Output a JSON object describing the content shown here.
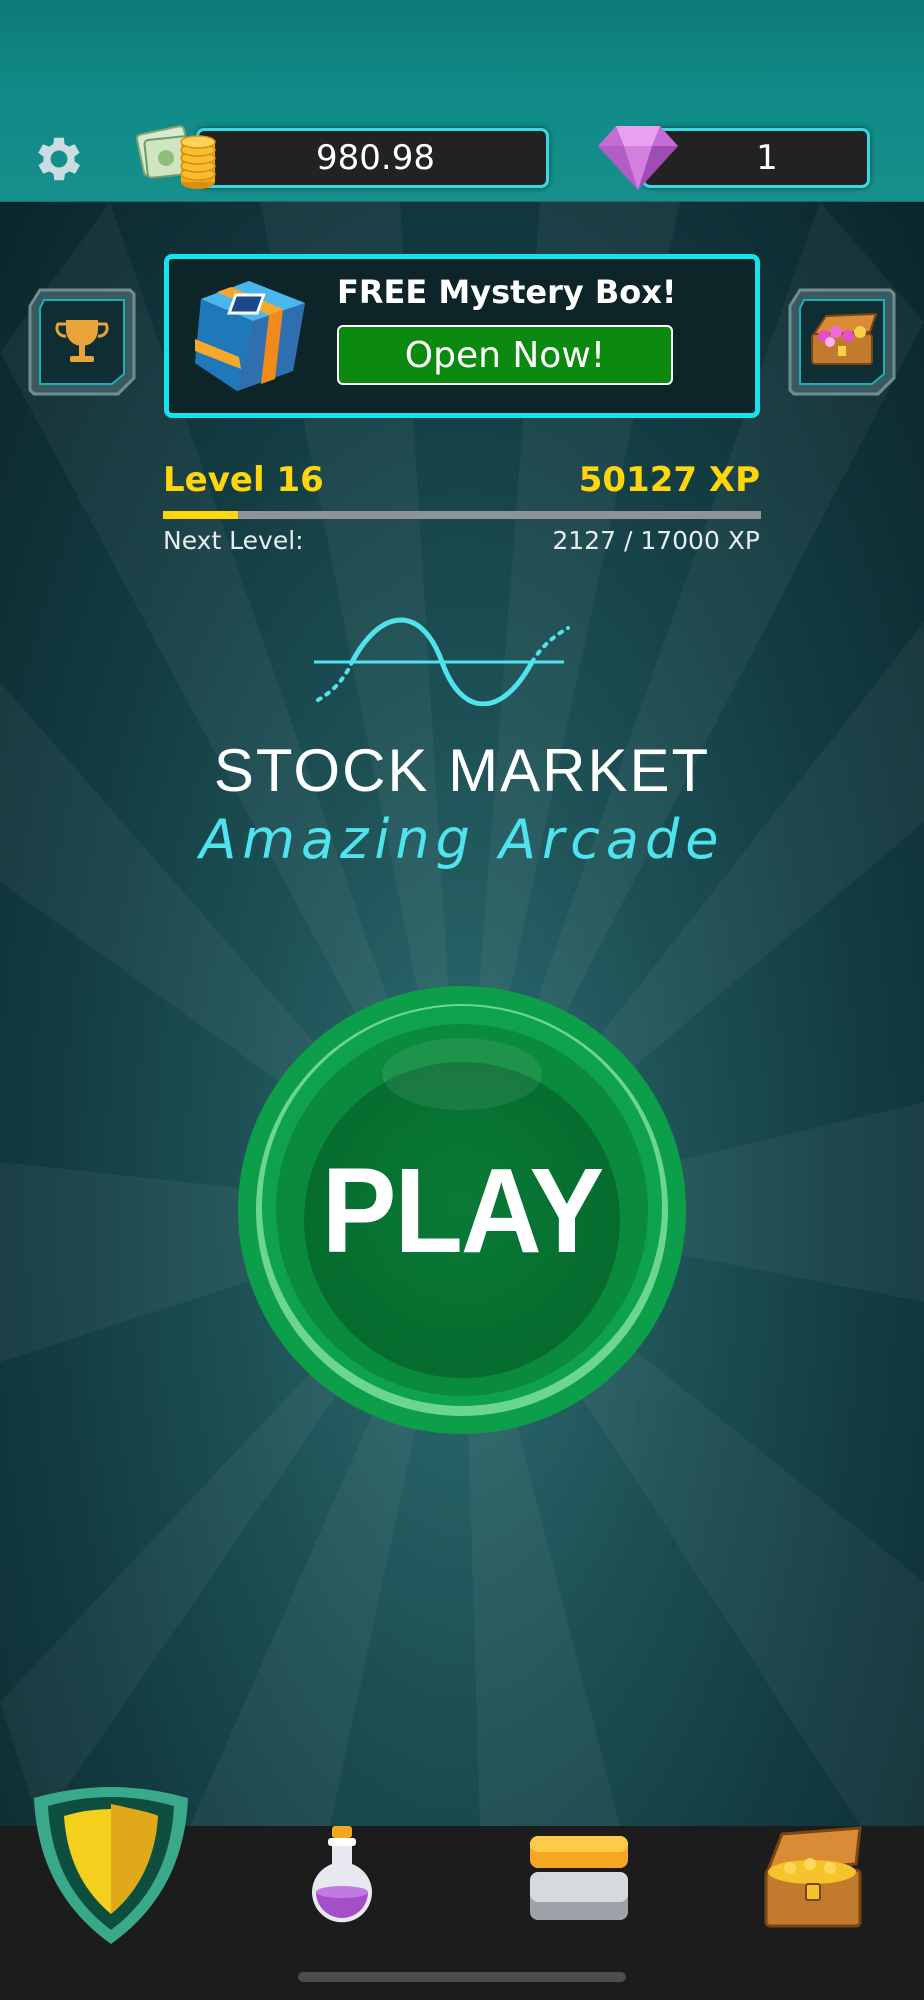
{
  "header": {
    "cash_value": "980.98",
    "gem_value": "1"
  },
  "mystery_box": {
    "title": "FREE Mystery Box!",
    "button_label": "Open Now!"
  },
  "level": {
    "level_label": "Level 16",
    "xp_label": "50127 XP",
    "next_level_label": "Next Level:",
    "next_level_value": "2127 / 17000 XP",
    "progress_fraction": 0.125
  },
  "logo": {
    "title": "STOCK MARKET",
    "subtitle": "Amazing Arcade"
  },
  "play": {
    "label": "PLAY"
  },
  "colors": {
    "accent_cyan": "#38d9e3",
    "xp_yellow": "#ffd60a",
    "play_green": "#0fa14a",
    "open_button_green": "#0b8a0f"
  },
  "icons": {
    "settings": "gear-icon",
    "cash": "cash-coins-icon",
    "gem": "gem-icon",
    "trophy": "trophy-icon",
    "treasure": "treasure-chest-icon",
    "mystery_box": "mystery-box-icon",
    "nav": [
      "shield-icon",
      "potion-icon",
      "cards-stack-icon",
      "treasure-chest-icon"
    ]
  }
}
